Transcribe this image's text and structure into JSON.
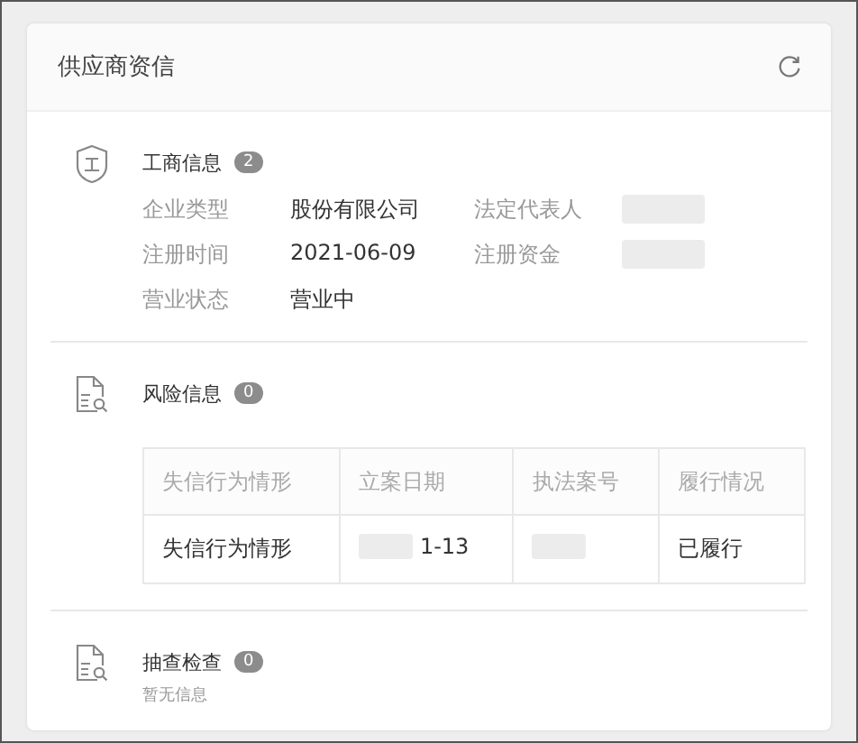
{
  "card": {
    "title": "供应商资信"
  },
  "sections": [
    {
      "kind": "fields",
      "title": "工商信息",
      "count": "2",
      "fields": [
        {
          "label": "企业类型",
          "value": "股份有限公司",
          "redacted": false
        },
        {
          "label": "法定代表人",
          "redacted": true
        },
        {
          "label": "注册时间",
          "value": "2021-06-09",
          "redacted": false
        },
        {
          "label": "注册资金",
          "redacted": true
        },
        {
          "label": "营业状态",
          "value": "营业中",
          "redacted": false
        }
      ]
    },
    {
      "kind": "table",
      "title": "风险信息",
      "count": "0",
      "columns": [
        "失信行为情形",
        "立案日期",
        "执法案号",
        "履行情况"
      ],
      "rows": [
        [
          {
            "text": "失信行为情形",
            "redacted": false
          },
          {
            "text": "1-13",
            "redacted": true
          },
          {
            "redacted": true
          },
          {
            "text": "已履行",
            "redacted": false
          }
        ]
      ]
    },
    {
      "kind": "empty",
      "title": "抽查检查",
      "count": "0",
      "note": "暂无信息"
    }
  ]
}
